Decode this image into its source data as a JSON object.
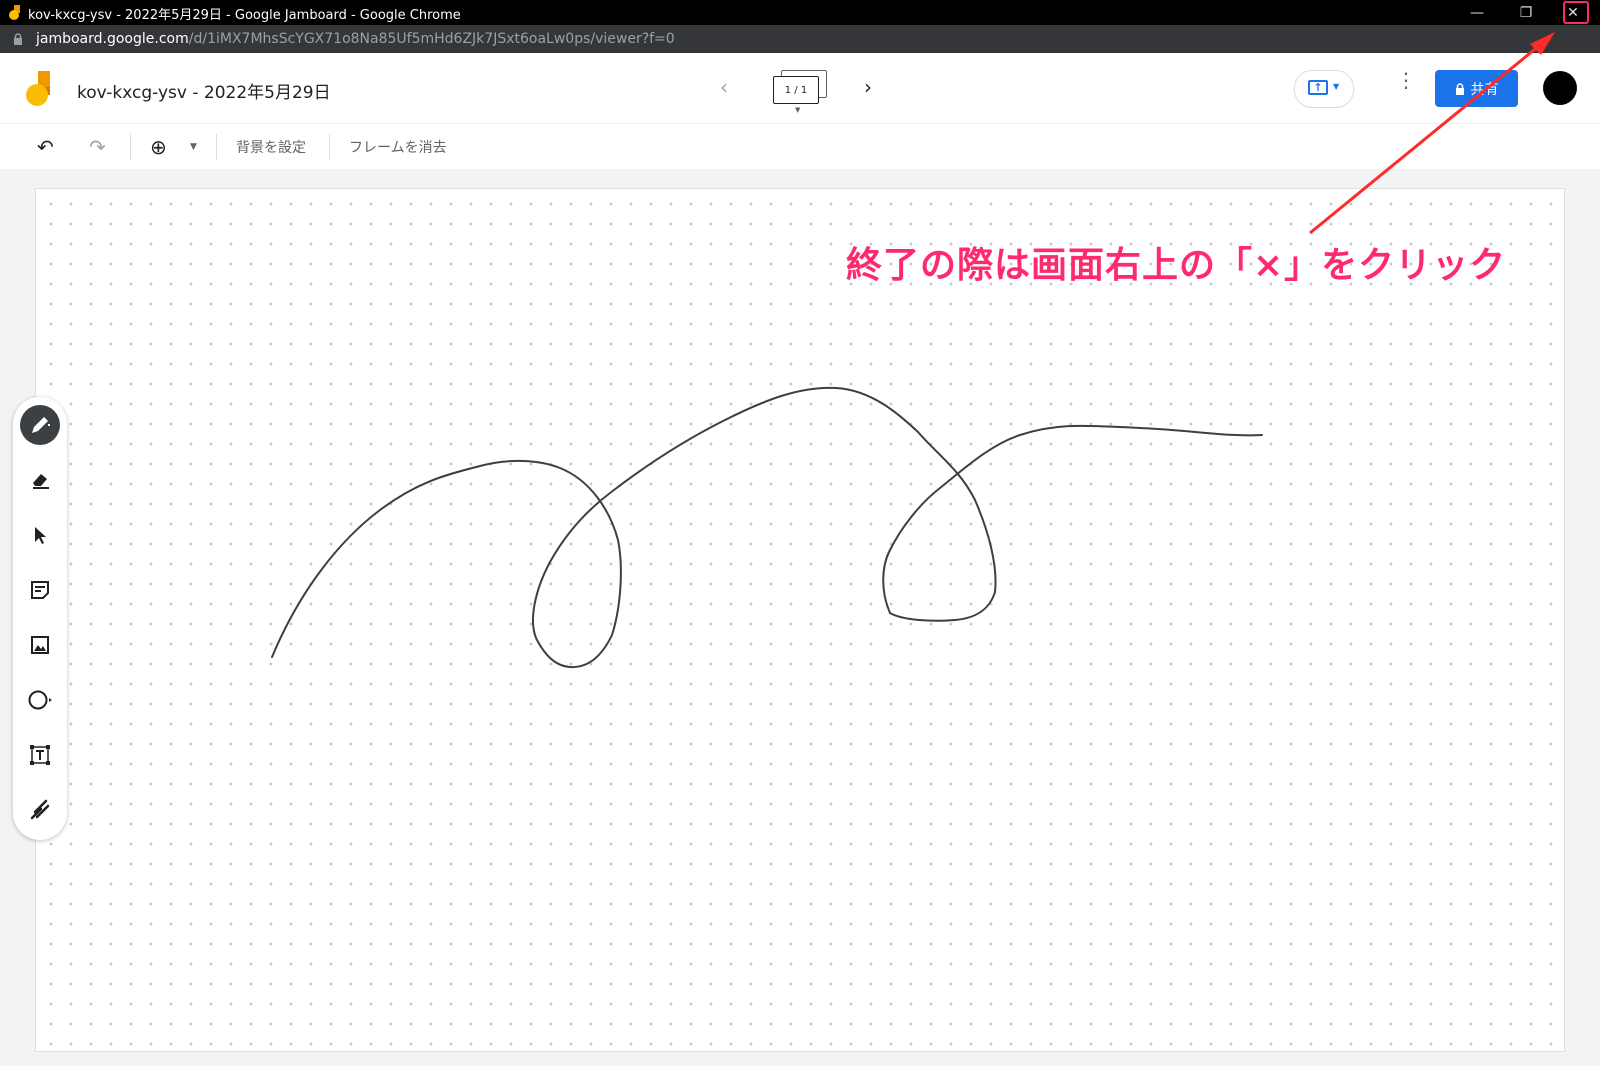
{
  "window": {
    "title": "kov-kxcg-ysv - 2022年5月29日 - Google Jamboard - Google Chrome",
    "minimize_glyph": "—",
    "restore_glyph": "❐",
    "close_glyph": "✕"
  },
  "address_bar": {
    "host": "jamboard.google.com",
    "path": "/d/1iMX7MhsScYGX71o8Na85Uf5mHd6ZJk7JSxt6oaLw0ps/viewer?f=0"
  },
  "header": {
    "doc_title": "kov-kxcg-ysv - 2022年5月29日",
    "prev_glyph": "‹",
    "next_glyph": "›",
    "frame_indicator": "1 / 1",
    "share_label": "共有",
    "more_glyph": "⋮"
  },
  "toolbar": {
    "undo_glyph": "↶",
    "redo_glyph": "↷",
    "zoom_glyph": "⊕",
    "set_background": "背景を設定",
    "clear_frame": "フレームを消去"
  },
  "tools": [
    {
      "name": "pen-tool",
      "icon": "pen-icon",
      "active": true
    },
    {
      "name": "eraser-tool",
      "icon": "eraser-icon",
      "active": false
    },
    {
      "name": "select-tool",
      "icon": "select-arrow-icon",
      "active": false
    },
    {
      "name": "sticky-note-tool",
      "icon": "sticky-note-icon",
      "active": false
    },
    {
      "name": "image-tool",
      "icon": "image-icon",
      "active": false
    },
    {
      "name": "shape-tool",
      "icon": "circle-icon",
      "active": false
    },
    {
      "name": "text-box-tool",
      "icon": "text-box-icon",
      "active": false
    },
    {
      "name": "laser-tool",
      "icon": "laser-icon",
      "active": false
    }
  ],
  "annotation": {
    "text": "終了の際は画面右上の「×」をクリック",
    "color": "#ff2a6d"
  },
  "colors": {
    "share_button": "#1a73e8",
    "annotation": "#ff2a6d",
    "titlebar": "#000000"
  }
}
